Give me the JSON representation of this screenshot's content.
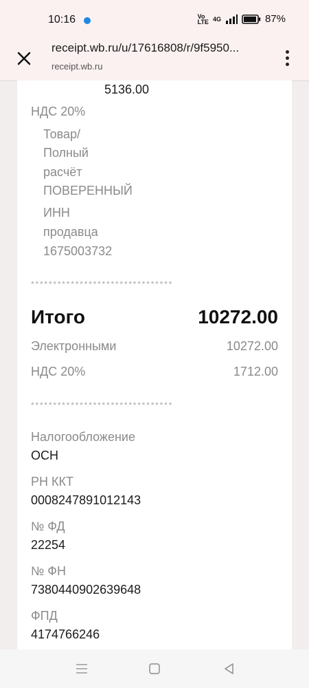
{
  "status_bar": {
    "time": "10:16",
    "network_label": "4G",
    "battery": "87%"
  },
  "browser": {
    "url": "receipt.wb.ru/u/17616808/r/9f5950...",
    "domain": "receipt.wb.ru"
  },
  "receipt": {
    "top_amount": "5136.00",
    "vat_label": "НДС 20%",
    "item_detail_lines": [
      "Товар/",
      "Полный",
      "расчёт",
      "ПОВЕРЕННЫЙ"
    ],
    "seller_inn_lines": [
      "ИНН",
      "продавца",
      "1675003732"
    ],
    "separator": "********************************",
    "total_label": "Итого",
    "total_value": "10272.00",
    "electronic_label": "Электронными",
    "electronic_value": "10272.00",
    "vat_total_label": "НДС 20%",
    "vat_total_value": "1712.00",
    "details": [
      {
        "label": "Налогообложение",
        "value": "ОСН"
      },
      {
        "label": "РН ККТ",
        "value": "0008247891012143"
      },
      {
        "label": "№ ФД",
        "value": "22254"
      },
      {
        "label": "№ ФН",
        "value": "7380440902639648"
      },
      {
        "label": "ФПД",
        "value": "4174766246"
      }
    ]
  },
  "icons": {
    "close": "close-icon",
    "menu": "more-vert-icon",
    "recent": "recent-apps-icon",
    "home": "home-icon",
    "back": "back-icon"
  }
}
